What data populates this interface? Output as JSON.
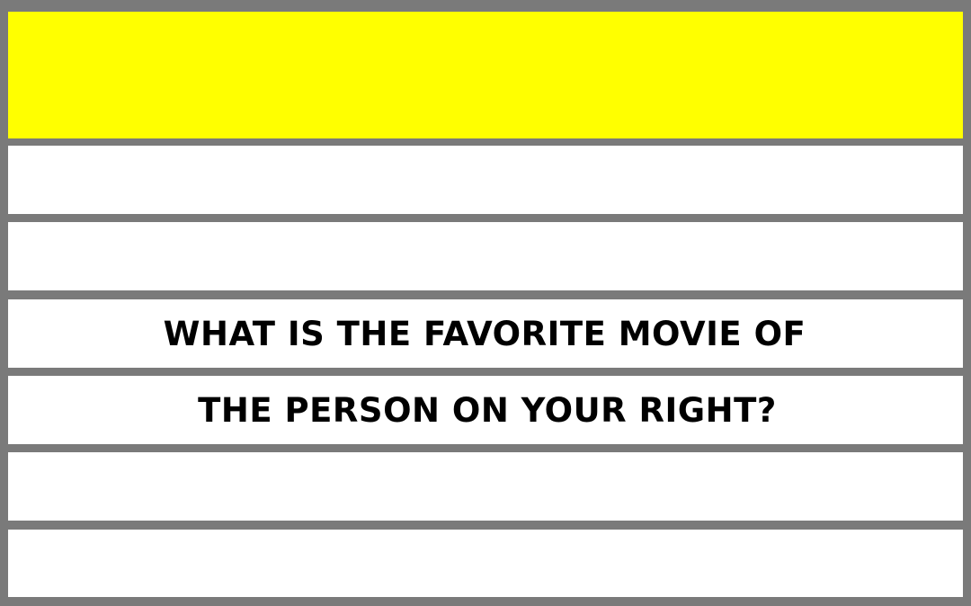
{
  "colors": {
    "frame": "#7a7a7a",
    "header": "#ffff00",
    "line": "#ffffff",
    "text": "#000000"
  },
  "question": {
    "line1": "WHAT IS THE FAVORITE MOVIE OF",
    "line2": "THE PERSON ON YOUR RIGHT?"
  }
}
